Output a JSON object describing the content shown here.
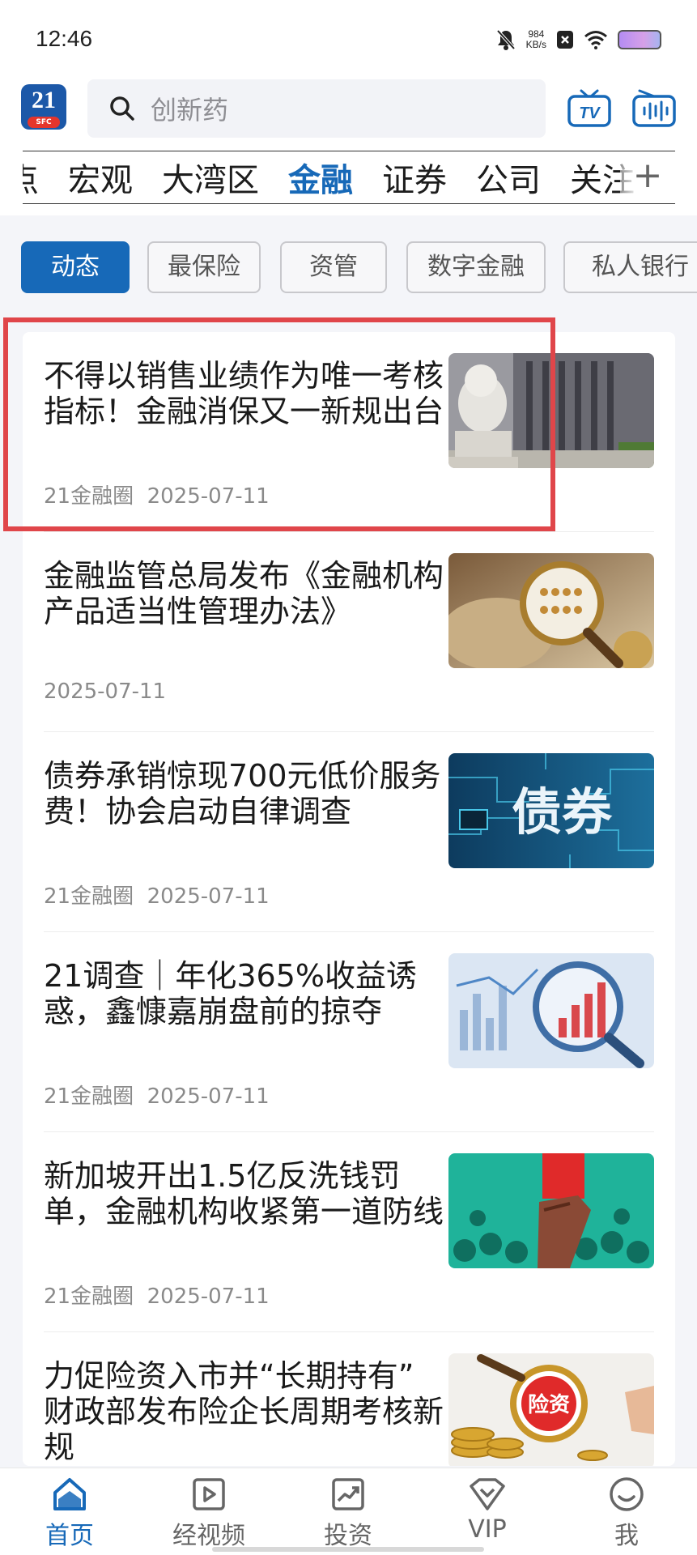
{
  "status_bar": {
    "time": "12:46",
    "net_speed_value": "984",
    "net_speed_unit": "KB/s",
    "icons": [
      "mute-icon",
      "sim-off-icon",
      "wifi-icon",
      "battery-icon"
    ]
  },
  "header": {
    "logo_text": "21",
    "logo_sub": "SFC",
    "search_placeholder": "创新药",
    "icons": [
      "search-icon",
      "tv-icon",
      "radio-icon"
    ]
  },
  "channels": {
    "items": [
      "点",
      "宏观",
      "大湾区",
      "金融",
      "证券",
      "公司",
      "关注"
    ],
    "active_index": 3,
    "more_label": "+"
  },
  "subtabs": {
    "items": [
      "动态",
      "最保险",
      "资管",
      "数字金融",
      "私人银行"
    ],
    "active_index": 0
  },
  "news": [
    {
      "title": "不得以销售业绩作为唯一考核指标！金融消保又一新规出台",
      "source": "21金融圈",
      "date": "2025-07-11",
      "thumb": "stone-lion-building-image"
    },
    {
      "title": "金融监管总局发布《金融机构产品适当性管理办法》",
      "source": "",
      "date": "2025-07-11",
      "thumb": "magnifier-abacus-image"
    },
    {
      "title": "债券承销惊现700元低价服务费！协会启动自律调查",
      "source": "21金融圈",
      "date": "2025-07-11",
      "thumb": "bond-circuit-image",
      "thumb_text": "债券"
    },
    {
      "title": "21调查｜年化365%收益诱惑，鑫慷嘉崩盘前的掠夺",
      "source": "21金融圈",
      "date": "2025-07-11",
      "thumb": "magnifier-chart-image"
    },
    {
      "title": "新加坡开出1.5亿反洗钱罚单，金融机构收紧第一道防线",
      "source": "21金融圈",
      "date": "2025-07-11",
      "thumb": "red-card-crowd-image"
    },
    {
      "title": "力促险资入市并“长期持有” 财政部发布险企长周期考核新规",
      "source": "",
      "date": "",
      "thumb": "insurance-funds-coins-image",
      "thumb_text": "险资"
    }
  ],
  "bottom_nav": {
    "items": [
      {
        "label": "首页",
        "icon": "home-icon"
      },
      {
        "label": "经视频",
        "icon": "video-icon"
      },
      {
        "label": "投资",
        "icon": "invest-chart-icon"
      },
      {
        "label": "VIP",
        "icon": "vip-icon"
      },
      {
        "label": "我",
        "icon": "profile-icon"
      }
    ],
    "active_index": 0
  },
  "colors": {
    "accent": "#1769b8",
    "highlight_border": "#e0464a",
    "background": "#f4f5f9"
  }
}
